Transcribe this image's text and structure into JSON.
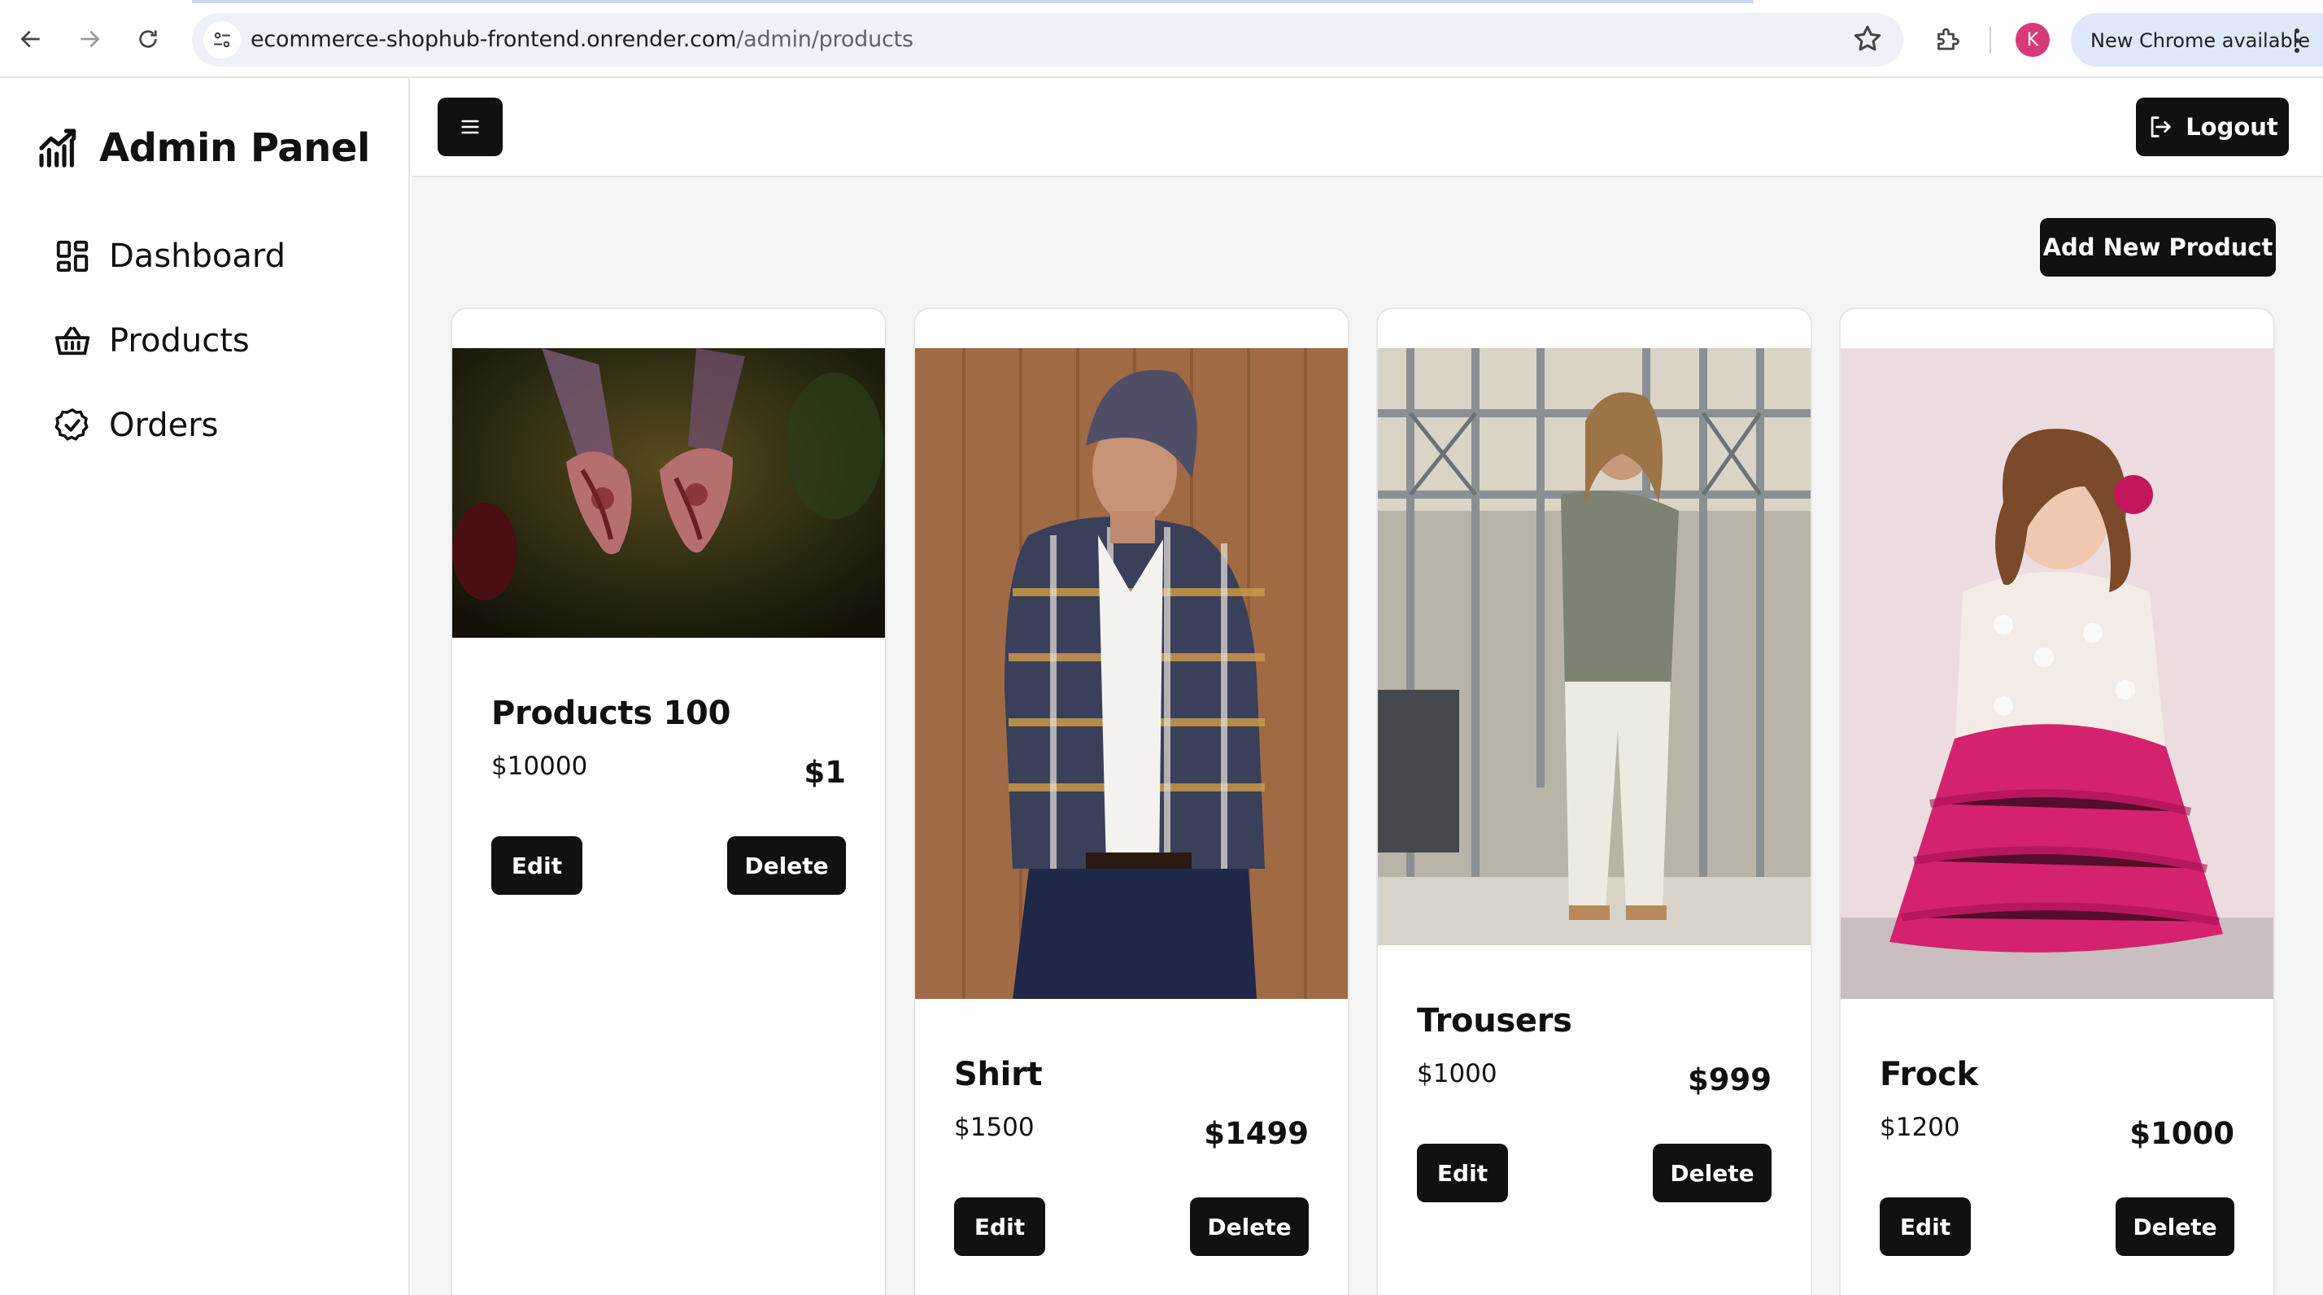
{
  "browser": {
    "url_host": "ecommerce-shophub-frontend.onrender.com",
    "url_path": "/admin/products",
    "profile_initial": "K",
    "update_label": "New Chrome available"
  },
  "sidebar": {
    "brand": "Admin Panel",
    "items": [
      {
        "label": "Dashboard",
        "icon": "dashboard-icon"
      },
      {
        "label": "Products",
        "icon": "basket-icon"
      },
      {
        "label": "Orders",
        "icon": "badge-check-icon"
      }
    ]
  },
  "header": {
    "logout_label": "Logout"
  },
  "main": {
    "add_button_label": "Add New Product",
    "products": [
      {
        "name": "Products 100",
        "price": "$10000",
        "sale_price": "$1",
        "edit_label": "Edit",
        "delete_label": "Delete",
        "image": "henna-hands-photo"
      },
      {
        "name": "Shirt",
        "price": "$1500",
        "sale_price": "$1499",
        "edit_label": "Edit",
        "delete_label": "Delete",
        "image": "man-plaid-shirt-photo"
      },
      {
        "name": "Trousers",
        "price": "$1000",
        "sale_price": "$999",
        "edit_label": "Edit",
        "delete_label": "Delete",
        "image": "man-white-trousers-photo"
      },
      {
        "name": "Frock",
        "price": "$1200",
        "sale_price": "$1000",
        "edit_label": "Edit",
        "delete_label": "Delete",
        "image": "girl-pink-frock-photo"
      }
    ]
  }
}
